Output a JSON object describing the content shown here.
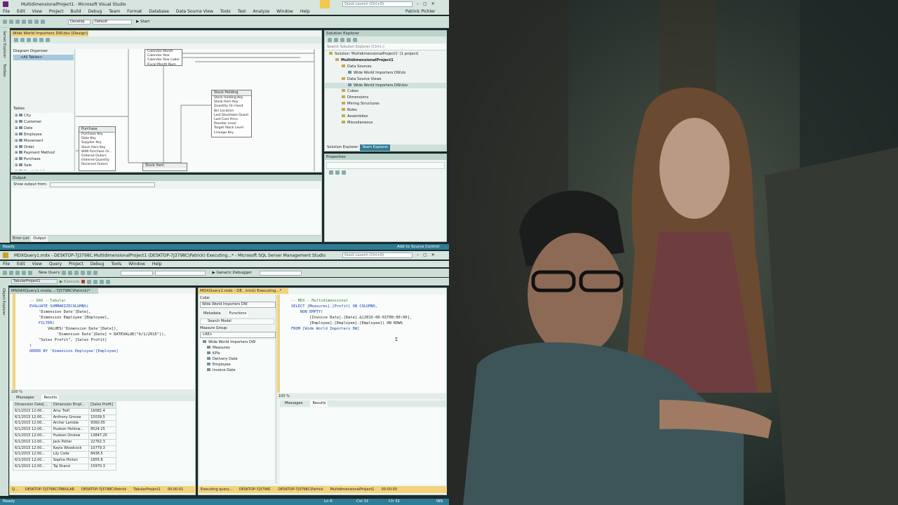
{
  "vs": {
    "title": "MultidimensionalProject1 - Microsoft Visual Studio",
    "quick_launch": "Quick Launch (Ctrl+Q)",
    "user": "Patrick Pichler",
    "menu": [
      "File",
      "Edit",
      "View",
      "Project",
      "Build",
      "Debug",
      "Team",
      "Format",
      "Database",
      "Data Source View",
      "Tools",
      "Test",
      "Analyze",
      "Window",
      "Help"
    ],
    "toolbar": {
      "config": "Develop",
      "platform": "Default",
      "start": "Start"
    },
    "side_tabs": [
      "Server Explorer",
      "Toolbox"
    ],
    "designer_tab": "Wide World Importers DW.dsv [Design]",
    "diagram_organizer": "Diagram Organizer",
    "all_tables": "<All Tables>",
    "tables_label": "Tables",
    "tables": [
      "City",
      "Customer",
      "Date",
      "Employee",
      "Movement",
      "Order",
      "Payment Method",
      "Purchase",
      "Sale",
      "Stock Holding"
    ],
    "diagram": {
      "date_fields": [
        "Calendar Month",
        "Calendar Year",
        "Calendar Year Label",
        "Fiscal Month Num"
      ],
      "stock_title": "Stock Holding",
      "stock_fields": [
        "Stock Holding Key",
        "Stock Item Key",
        "Quantity On Hand",
        "Bin Location",
        "Last Stocktake Quant",
        "Last Cost Price",
        "Reorder Level",
        "Target Stock Level",
        "Lineage Key"
      ],
      "purchase_title": "Purchase",
      "purchase_fields": [
        "Purchase Key",
        "Date Key",
        "Supplier Key",
        "Stock Item Key",
        "WWI Purchase Or...",
        "Ordered Outers",
        "Ordered Quantity",
        "Received Outers"
      ],
      "stockitem_title": "Stock Item"
    },
    "solution_explorer": {
      "title": "Solution Explorer",
      "search": "Search Solution Explorer (Ctrl+;)",
      "items": [
        {
          "label": "Solution 'MultidimensionalProject1' (1 project)",
          "level": 0
        },
        {
          "label": "MultidimensionalProject1",
          "level": 1
        },
        {
          "label": "Data Sources",
          "level": 2
        },
        {
          "label": "Wide World Importers DW.ds",
          "level": 3
        },
        {
          "label": "Data Source Views",
          "level": 2
        },
        {
          "label": "Wide World Importers DW.dsv",
          "level": 3
        },
        {
          "label": "Cubes",
          "level": 2
        },
        {
          "label": "Dimensions",
          "level": 2
        },
        {
          "label": "Mining Structures",
          "level": 2
        },
        {
          "label": "Roles",
          "level": 2
        },
        {
          "label": "Assemblies",
          "level": 2
        },
        {
          "label": "Miscellaneous",
          "level": 2
        }
      ],
      "tabs": [
        "Solution Explorer",
        "Team Explorer"
      ]
    },
    "properties_title": "Properties",
    "output": {
      "title": "Output",
      "show_from": "Show output from:",
      "tabs": [
        "Error List",
        "Output"
      ]
    },
    "status": {
      "left": "Ready",
      "right": "Add to Source Control"
    }
  },
  "ssms": {
    "title": "MDXQuery1.mdx - DESKTOP-7J3798C.MultidimensionalProject1 (DESKTOP-7J3798C\\Patrick) Executing...* - Microsoft SQL Server Management Studio",
    "quick_launch": "Quick Launch (Ctrl+Q)",
    "menu": [
      "File",
      "Edit",
      "View",
      "Query",
      "Project",
      "Debug",
      "Tools",
      "Window",
      "Help"
    ],
    "toolbar": {
      "new_query": "New Query",
      "debugger": "Generic Debugger",
      "execute": "Execute",
      "db": "TabularProject1"
    },
    "side_tab": "Object Explorer",
    "left": {
      "tab": "MSDAXQuery1.msda...-7J3798C\\Patrick)*",
      "code": [
        {
          "text": "-- DAX - Tabular",
          "cls": "cm"
        },
        {
          "text": "EVALUATE SUMMARIZECOLUMNS(",
          "cls": "kw"
        },
        {
          "text": "    'Dimension Date'[Date],",
          "cls": ""
        },
        {
          "text": "    'Dimension Employee'[Employee],",
          "cls": ""
        },
        {
          "text": "    FILTER(",
          "cls": "kw"
        },
        {
          "text": "        VALUES('Dimension Date'[Date]),",
          "cls": ""
        },
        {
          "text": "            'Dimension Date'[Date] = DATEVALUE(\"6/1/2015\")),",
          "cls": ""
        },
        {
          "text": "    \"Sales Profit\", [Sales Profit]",
          "cls": ""
        },
        {
          "text": ")",
          "cls": ""
        },
        {
          "text": "ORDER BY 'Dimension Employee'[Employee]",
          "cls": "kw"
        }
      ],
      "zoom": "100 %",
      "result_tabs": [
        "Messages",
        "Results"
      ],
      "columns": [
        "Dimension Date[...",
        "Dimension Empl...",
        "[Sales Profit]"
      ],
      "rows": [
        [
          "6/1/2015 12:00...",
          "Amy Trefl",
          "16082.4"
        ],
        [
          "6/1/2015 12:00...",
          "Anthony Grosse",
          "15039.5"
        ],
        [
          "6/1/2015 12:00...",
          "Archer Lamble",
          "9360.05"
        ],
        [
          "6/1/2015 12:00...",
          "Hudson Hollinw...",
          "8524.25"
        ],
        [
          "6/1/2015 12:00...",
          "Hudson Onslow",
          "13847.25"
        ],
        [
          "6/1/2015 12:00...",
          "Jack Potter",
          "22762.3"
        ],
        [
          "6/1/2015 12:00...",
          "Kayla Woodcock",
          "10779.3"
        ],
        [
          "6/1/2015 12:00...",
          "Lily Code",
          "8436.5"
        ],
        [
          "6/1/2015 12:00...",
          "Sophia Hinton",
          "1855.8"
        ],
        [
          "6/1/2015 12:00...",
          "Taj Shand",
          "15970.3"
        ]
      ],
      "status": [
        "Q...",
        "DESKTOP-7J3798C\\TABULAR",
        "DESKTOP-7J3798C\\Patrick",
        "TabularProject1",
        "00:00:01"
      ]
    },
    "mdx": {
      "tab": "MDXQuery1.mdx - DE...trick) Executing...*",
      "cube_label": "Cube:",
      "cube": "Wide World Importers DW",
      "tabs": [
        "Metadata",
        "Functions"
      ],
      "search_model": "Search Model",
      "measure_group_label": "Measure Group:",
      "measure_group": "<All>",
      "tree": [
        "Wide World Importers DW",
        "Measures",
        "KPIs",
        "Delivery Date",
        "Employee",
        "Invoice Date"
      ],
      "code": [
        {
          "text": "-- MDX - Multidimensional",
          "cls": "cm"
        },
        {
          "text": "SELECT [Measures].[Profit] ON COLUMNS,",
          "cls": "kw"
        },
        {
          "text": "    NON EMPTY(",
          "cls": "kw"
        },
        {
          "text": "        [Invoice Date].[Date].&[2015-06-01T00:00:00],",
          "cls": ""
        },
        {
          "text": "        [Employee].[Employee].[Employee]) ON ROWS",
          "cls": ""
        },
        {
          "text": "FROM [Wide World Importers DW]",
          "cls": "kw"
        }
      ],
      "zoom": "100 %",
      "result_tabs": [
        "Messages",
        "Results"
      ],
      "status": [
        "Executing query...",
        "DESKTOP-7J3798C",
        "DESKTOP-7J3798C\\Patrick",
        "MultidimensionalProject1",
        "00:00:00"
      ]
    },
    "status": {
      "left": "Ready",
      "ln": "Ln 6",
      "col": "Col 31",
      "ch": "Ch 31",
      "mode": "INS"
    }
  }
}
